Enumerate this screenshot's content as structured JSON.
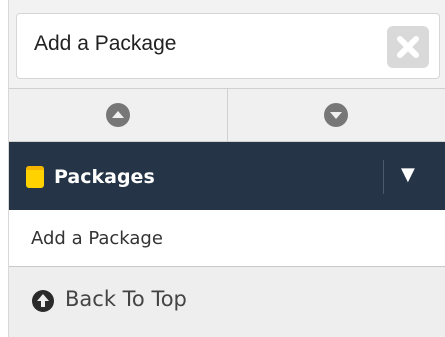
{
  "header": {
    "title": "Add a Package",
    "close_icon": "close-icon"
  },
  "arrows": {
    "up_icon": "chevron-up-circle-icon",
    "down_icon": "chevron-down-circle-icon"
  },
  "section": {
    "label": "Packages",
    "icon": "package-icon",
    "caret": "▼"
  },
  "menu": {
    "items": [
      {
        "label": "Add a Package"
      }
    ]
  },
  "footer": {
    "back_to_top_label": "Back To Top",
    "back_to_top_icon": "arrow-up-circle-icon"
  },
  "colors": {
    "section_bg": "#253446",
    "package_icon": "#ffd200",
    "panel_bg": "#f2f2f2"
  }
}
